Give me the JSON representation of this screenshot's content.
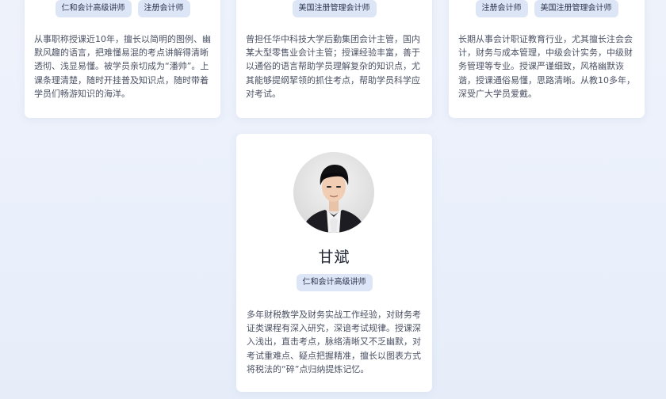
{
  "teachers": [
    {
      "tags": [
        "仁和会计高级讲师",
        "注册会计师"
      ],
      "desc": "从事职称授课近10年，擅长以简明的图例、幽默风趣的语言，把难懂易混的考点讲解得清晰透彻、浅显易懂。被学员亲切成为“潘帅”。上课条理清楚，随时开挂普及知识点，随时带着学员们畅游知识的海洋。"
    },
    {
      "tags": [
        "美国注册管理会计师"
      ],
      "desc": "曾担任华中科技大学后勤集团会计主管，国内某大型零售业会计主管；授课经验丰富，善于以通俗的语言帮助学员理解复杂的知识点，尤其能够提纲挈领的抓住考点，帮助学员科学应对考试。"
    },
    {
      "tags": [
        "注册会计师",
        "美国注册管理会计师"
      ],
      "desc": "长期从事会计职证教育行业，尤其擅长注会会计，财务与成本管理，中级会计实务，中级财务管理等专业。授课严谨细致，风格幽默诙谐，授课通俗易懂，思路清晰。从教10多年，深受广大学员爱戴。"
    },
    {
      "name": "甘斌",
      "tags": [
        "仁和会计高级讲师"
      ],
      "desc": "多年财税教学及财务实战工作经验，对财务考证类课程有深入研究，深谙考试规律。授课深入浅出，直击考点，脉络清晰又不乏幽默，对考试重难点、疑点把握精准，擅长以图表方式将税法的“碎”点归纳提炼记忆。"
    }
  ]
}
